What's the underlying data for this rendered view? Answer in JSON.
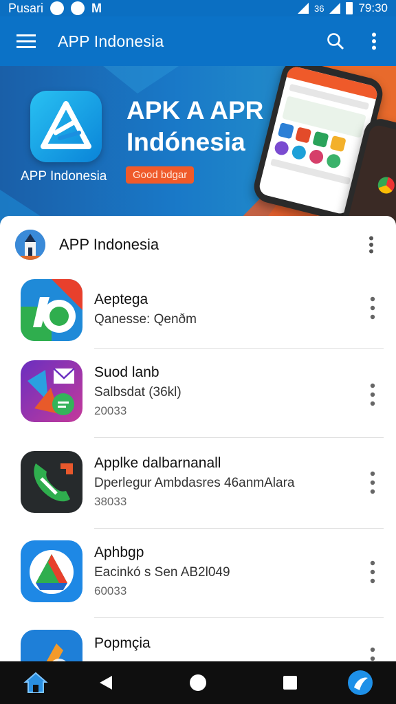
{
  "status_bar": {
    "carrier": "Pusari",
    "extra": "M",
    "signal_text": "36",
    "time": "79:30"
  },
  "app_bar": {
    "title": "APP Indonesia"
  },
  "banner": {
    "logo_label": "APP Indonesia",
    "headline_line1": "APK A APR",
    "headline_line2": "Indónesia",
    "cta_label": "Good bdgar"
  },
  "list_header": {
    "title": "APP Indonesia"
  },
  "apps": [
    {
      "name": "Aeptega",
      "subtitle": "Qanesse: Qenðm",
      "meta": ""
    },
    {
      "name": "Suod lanb",
      "subtitle": "Salbsdat (36kl)",
      "meta": "20033"
    },
    {
      "name": "Applke dalbarnanall",
      "subtitle": "Dperlegur Ambdasres 46anmAlara",
      "meta": "38033"
    },
    {
      "name": "Aphbgp",
      "subtitle": "Eacinkó s Sen AB2l049",
      "meta": "60033"
    },
    {
      "name": "Popmçia",
      "subtitle": "",
      "meta": ""
    }
  ],
  "colors": {
    "app_bar": "#0b72c7",
    "banner": "#1979c8",
    "accent_orange": "#ef5a2a",
    "nav_bar": "#0f0f0f"
  },
  "nav": {
    "icons": [
      "home-icon",
      "back-icon",
      "home-circle-icon",
      "recents-icon",
      "app-launcher-icon"
    ]
  }
}
